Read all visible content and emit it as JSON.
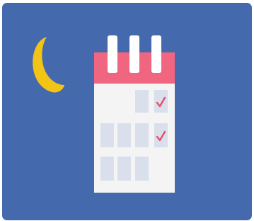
{
  "illustration": {
    "subject": "calendar-with-checkmarks-at-night",
    "icons": {
      "moon": "crescent-moon-icon",
      "calendar": "calendar-icon",
      "check": "check-mark-icon"
    },
    "colors": {
      "background": "#4569ad",
      "moon": "#f3c316",
      "calendar_header": "#f06680",
      "calendar_body": "#f4f4f4",
      "calendar_rings": "#ffffff",
      "calendar_cell": "#d9dfeb",
      "check": "#ea4d6a"
    },
    "calendar": {
      "ring_count": 3,
      "checked_cells": 2
    }
  }
}
